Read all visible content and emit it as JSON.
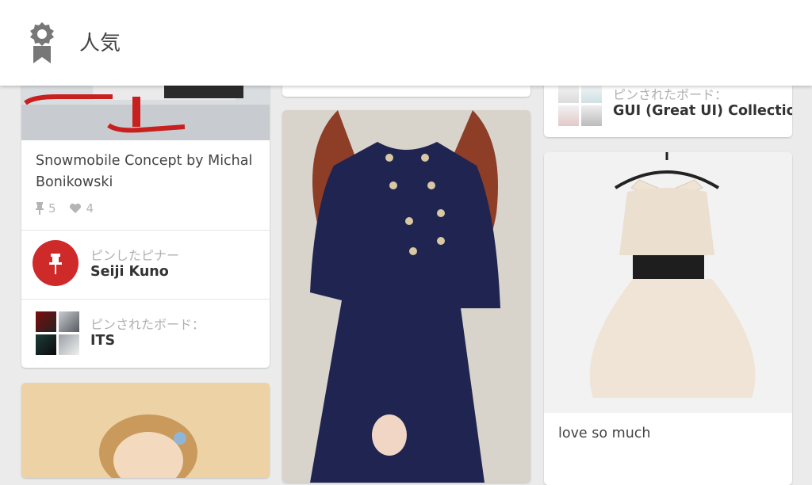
{
  "header": {
    "title": "人気",
    "icon": "badge-icon"
  },
  "pins": {
    "snowmobile": {
      "description": "Snowmobile Concept by Michal Bonikowski",
      "repins": "5",
      "likes": "4",
      "pinner_label": "ピンしたピナー",
      "pinner_name": "Seiji Kuno",
      "board_label": "ピンされたボード：",
      "board_name": "ITS"
    },
    "gui_collection": {
      "board_label": "ピンされたボード：",
      "board_name": "GUI (Great UI) Collection"
    },
    "navy_dress": {},
    "white_dress": {
      "description": "love so much"
    },
    "portrait": {}
  },
  "colors": {
    "accent": "#cf2a2a",
    "background": "#ebebeb"
  }
}
